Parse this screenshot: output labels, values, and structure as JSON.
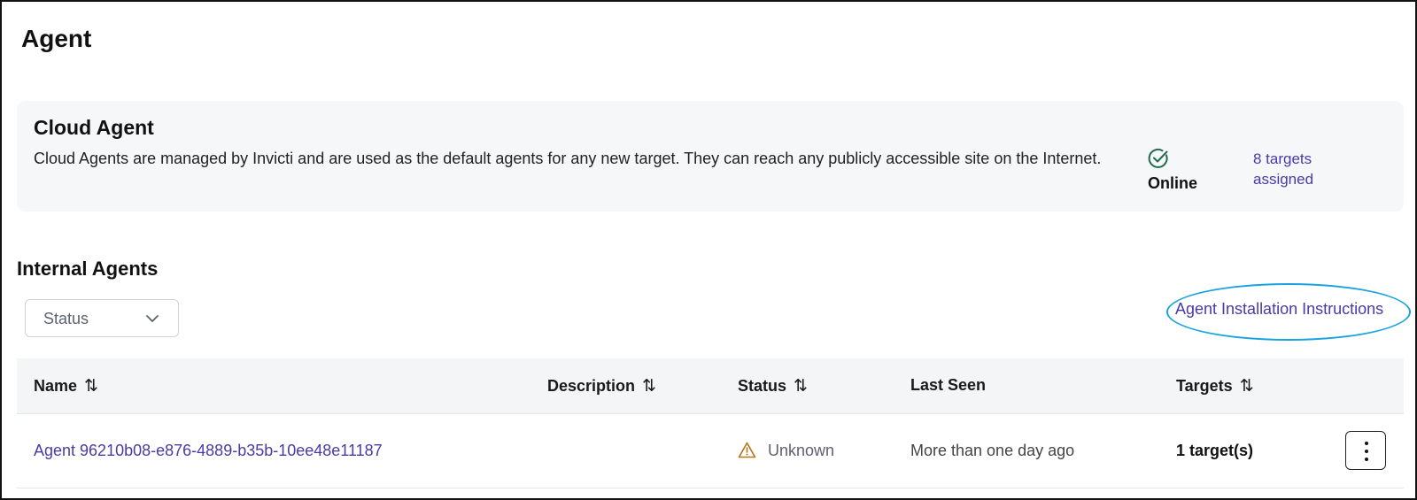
{
  "page": {
    "title": "Agent"
  },
  "cloud_agent": {
    "title": "Cloud Agent",
    "description": "Cloud Agents are managed by Invicti and are used as the default agents for any new target. They can reach any publicly accessible site on the Internet.",
    "status_label": "Online",
    "status_icon": "check-circle-icon",
    "targets_link": "8 targets assigned"
  },
  "internal_agents": {
    "title": "Internal Agents",
    "status_filter": {
      "placeholder": "Status",
      "icon": "chevron-down-icon"
    },
    "install_link": "Agent Installation Instructions",
    "table": {
      "columns": [
        {
          "label": "Name",
          "sortable": true
        },
        {
          "label": "Description",
          "sortable": true
        },
        {
          "label": "Status",
          "sortable": true
        },
        {
          "label": "Last Seen",
          "sortable": false
        },
        {
          "label": "Targets",
          "sortable": true
        }
      ],
      "sort_icon": "⇅",
      "rows": [
        {
          "name": "Agent 96210b08-e876-4889-b35b-10ee48e11187",
          "description": "",
          "status": "Unknown",
          "status_icon": "warning-icon",
          "last_seen": "More than one day ago",
          "targets": "1 target(s)",
          "menu_icon": "more-vertical-icon"
        }
      ]
    }
  },
  "colors": {
    "link": "#4a3aa8",
    "online_icon": "#1f6b4a",
    "warning_icon": "#b5731a",
    "highlight": "#1aa3e0",
    "card_background": "#f6f7f9"
  }
}
